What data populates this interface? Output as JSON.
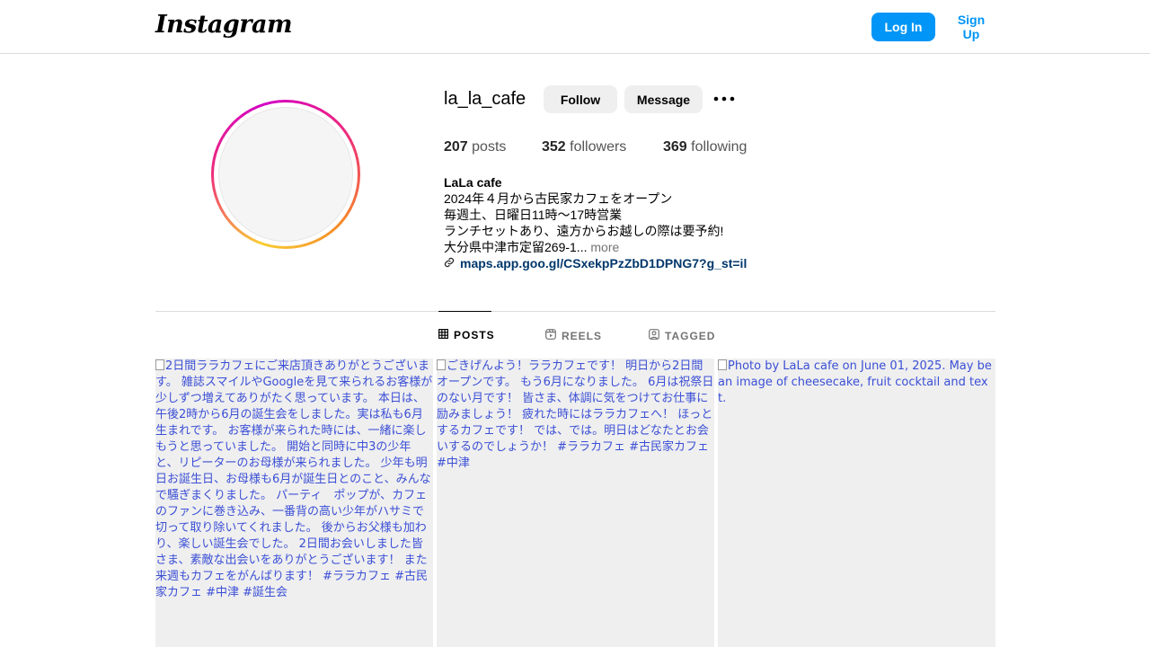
{
  "nav": {
    "logo": "Instagram",
    "login_label": "Log In",
    "signup_label": "Sign Up"
  },
  "profile": {
    "username": "la_la_cafe",
    "follow_label": "Follow",
    "message_label": "Message",
    "more_icon": "more-options-icon",
    "stats": {
      "posts_count": "207",
      "posts_label": "posts",
      "followers_count": "352",
      "followers_label": "followers",
      "following_count": "369",
      "following_label": "following"
    },
    "bio": {
      "name": "LaLa cafe",
      "lines": [
        "2024年４月から古民家カフェをオープン",
        "毎週土、日曜日11時〜17時営業",
        "ランチセットあり、遠方からお越しの際は要予約!",
        "大分県中津市定留269-1..."
      ],
      "more_label": "more",
      "link": "maps.app.goo.gl/CSxekpPzZbD1DPNG7?g_st=il"
    }
  },
  "tabs": [
    {
      "label": "POSTS",
      "icon": "grid-icon",
      "active": true
    },
    {
      "label": "REELS",
      "icon": "reels-icon",
      "active": false
    },
    {
      "label": "TAGGED",
      "icon": "tagged-icon",
      "active": false
    }
  ],
  "posts": [
    {
      "alt": "2日間ララカフェにご来店頂きありがとうございます。 雑誌スマイルやGoogleを見て来られるお客様が少しずつ増えてありがたく思っています。 本日は、午後2時から6月の誕生会をしました。実は私も6月生まれです。 お客様が来られた時には、一緒に楽しもうと思っていました。 開始と同時に中3の少年と、リピーターのお母様が来られました。 少年も明日お誕生日、お母様も6月が誕生日とのこと、みんなで騒ぎまくりました。 パーティ　ポップが、カフェのファンに巻き込み、一番背の高い少年がハサミで切って取り除いてくれました。 後からお父様も加わり、楽しい誕生会でした。 2日間お会いしました皆さま、素敵な出会いをありがとうございます！ また来週もカフェをがんばります！ #ララカフェ #古民家カフェ #中津 #誕生会"
    },
    {
      "alt": "ごきげんよう！ララカフェです！ 明日から2日間オープンです。 もう6月になりました。 6月は祝祭日のない月です！ 皆さま、体調に気をつけてお仕事に励みましょう！ 疲れた時にはララカフェへ！ ほっとするカフェです！ では、では。明日はどなたとお会いするのでしょうか！ #ララカフェ #古民家カフェ #中津"
    },
    {
      "alt": "Photo by LaLa cafe on June 01, 2025. May be an image of cheesecake, fruit cocktail and text."
    }
  ],
  "colors": {
    "primary_blue": "#0095f6",
    "link_blue": "#00376b",
    "button_gray": "#efefef",
    "alt_text_blue": "#3b4fd6"
  }
}
